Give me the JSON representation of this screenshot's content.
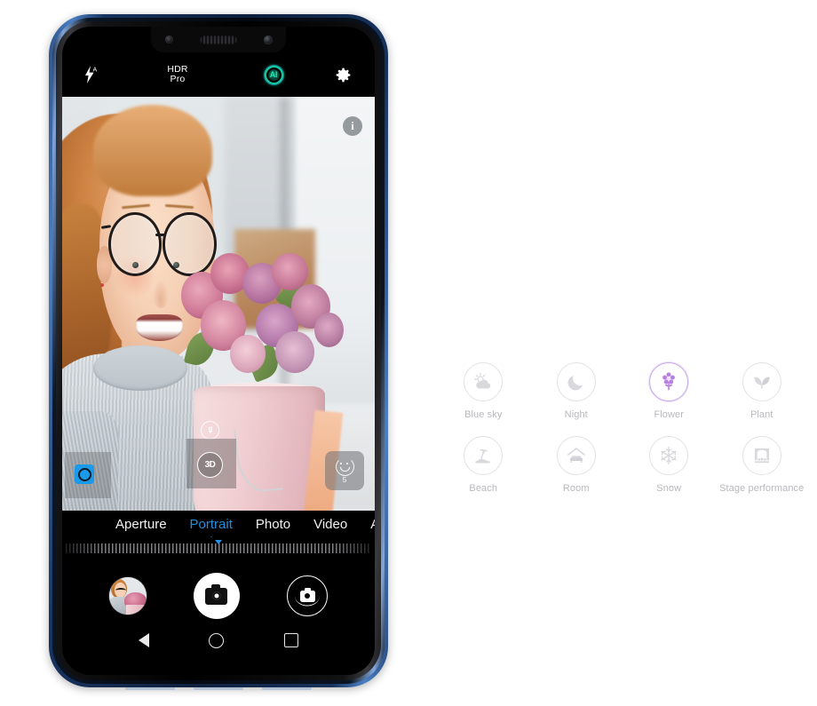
{
  "device": {
    "name": "smartphone-camera-mockup",
    "frame_color": "#2b4f86"
  },
  "camera_ui": {
    "topbar": {
      "flash_icon": "flash-auto-icon",
      "hdr_line1": "HDR",
      "hdr_line2": "Pro",
      "ai_label": "AI",
      "ai_color": "#21e6a8",
      "settings_icon": "gear-icon"
    },
    "viewfinder": {
      "info_label": "i",
      "scene_badge_icon": "flower-scene-icon",
      "three_d_label": "3D",
      "bokeh_icon": "aperture-bokeh-icon",
      "beauty_icon": "beauty-face-icon",
      "beauty_level": "5"
    },
    "modes": [
      {
        "label": "Aperture",
        "active": false
      },
      {
        "label": "Portrait",
        "active": true
      },
      {
        "label": "Photo",
        "active": false
      },
      {
        "label": "Video",
        "active": false
      },
      {
        "label": "A",
        "active": false
      }
    ],
    "accent_color": "#1f8fe0",
    "controls": {
      "gallery_label": "gallery-thumbnail",
      "shutter_label": "shutter-button",
      "flip_label": "switch-camera-button"
    },
    "navbar": {
      "back": "back-button",
      "home": "home-button",
      "recents": "recents-button"
    }
  },
  "scenes": {
    "highlight_color": "#c9a9ee",
    "items": [
      {
        "label": "Blue sky",
        "icon": "blue-sky-icon",
        "active": false
      },
      {
        "label": "Night",
        "icon": "moon-icon",
        "active": false
      },
      {
        "label": "Flower",
        "icon": "flower-icon",
        "active": true
      },
      {
        "label": "Plant",
        "icon": "leaf-icon",
        "active": false
      },
      {
        "label": "Beach",
        "icon": "beach-icon",
        "active": false
      },
      {
        "label": "Room",
        "icon": "room-sofa-icon",
        "active": false
      },
      {
        "label": "Snow",
        "icon": "snowflake-icon",
        "active": false
      },
      {
        "label": "Stage performance",
        "icon": "stage-icon",
        "active": false
      }
    ]
  }
}
